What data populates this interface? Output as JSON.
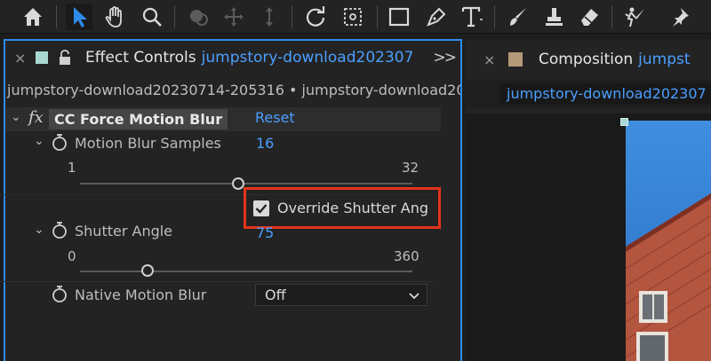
{
  "toolbar": {
    "tools": [
      "home-icon",
      "selection-icon",
      "hand-icon",
      "zoom-icon",
      "orbit-icon",
      "pan-icon",
      "dolly-icon",
      "rotate-icon",
      "anchor-icon",
      "rectangle-icon",
      "pen-icon",
      "type-icon",
      "brush-icon",
      "clone-stamp-icon",
      "eraser-icon",
      "roto-brush-icon",
      "puppet-pin-icon"
    ],
    "active_tool": "selection-icon",
    "accent": "#2d8ceb"
  },
  "effect_controls": {
    "tab_close": "×",
    "tab_title": "Effect Controls",
    "tab_link": "jumpstory-download202307",
    "swatch_color": "#a8d8d0",
    "breadcrumb": "jumpstory-download20230714-205316 • jumpstory-download20",
    "effect": {
      "fx": "fx",
      "name": "CC Force Motion Blur",
      "reset_label": "Reset"
    },
    "motion_blur_samples": {
      "label": "Motion Blur Samples",
      "value": "16",
      "min": "1",
      "max": "32"
    },
    "override": {
      "label": "Override Shutter Ang",
      "checked": true
    },
    "shutter_angle": {
      "label": "Shutter Angle",
      "value": "75",
      "min": "0",
      "max": "360"
    },
    "native_motion_blur": {
      "label": "Native Motion Blur",
      "selected": "Off"
    },
    "highlight_color": "#e3341c"
  },
  "composition": {
    "tab_close": "×",
    "tab_title": "Composition",
    "tab_link": "jumpst",
    "swatch_color": "#b59a7a",
    "sub_tab": "jumpstory-download202307"
  }
}
